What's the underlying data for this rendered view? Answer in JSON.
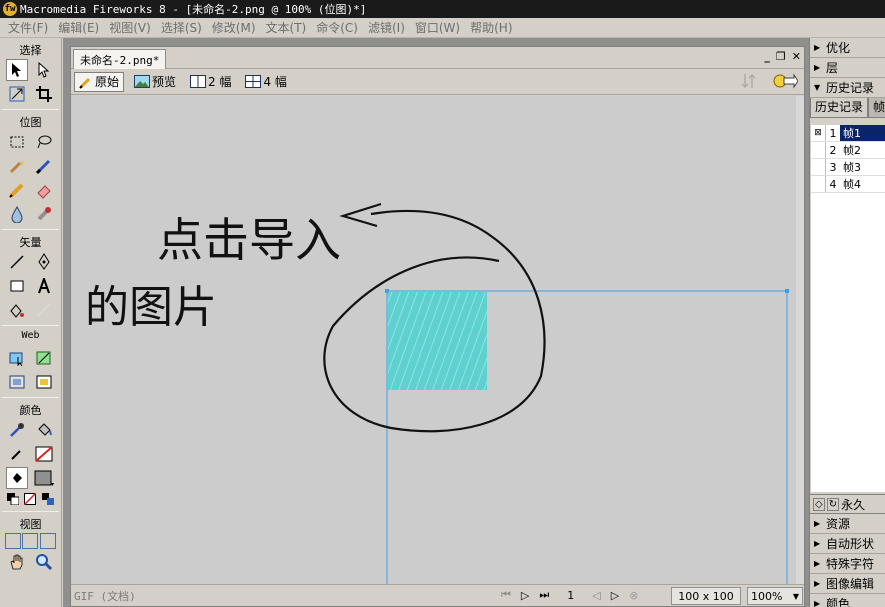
{
  "titlebar": {
    "title": "Macromedia Fireworks 8 - [未命名-2.png @ 100% (位图)*]"
  },
  "menu": [
    "文件(F)",
    "编辑(E)",
    "视图(V)",
    "选择(S)",
    "修改(M)",
    "文本(T)",
    "命令(C)",
    "滤镜(I)",
    "窗口(W)",
    "帮助(H)"
  ],
  "tools": {
    "select_label": "选择",
    "bitmap_label": "位图",
    "vector_label": "矢量",
    "web_label": "Web",
    "color_label": "颜色",
    "view_label": "视图"
  },
  "document": {
    "tab": "未命名-2.png*",
    "views": [
      "原始",
      "预览",
      "2 幅",
      "4 幅"
    ],
    "status_format": "GIF (文档)",
    "frame_number": "1",
    "dimensions": "100 x 100",
    "zoom": "100%"
  },
  "canvas": {
    "annotation_line1": "点击导入",
    "annotation_line2": "的图片",
    "image_color": "#5fd0d0",
    "selection_color": "#3aa0e8"
  },
  "panels": {
    "optimize": "优化",
    "layers": "层",
    "history": "历史记录",
    "tabs": [
      "历史记录",
      "帧"
    ],
    "frames": [
      "帧1",
      "帧2",
      "帧3",
      "帧4"
    ],
    "loop": "永久",
    "assets": "资源",
    "auto_shapes": "自动形状",
    "special_chars": "特殊字符",
    "image_edit": "图像编辑",
    "colors": "颜色"
  }
}
